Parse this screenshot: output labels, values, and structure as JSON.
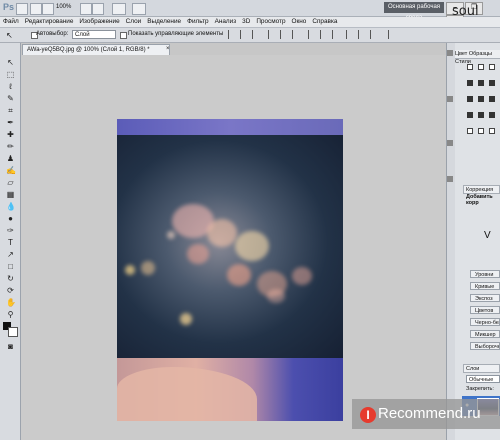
{
  "app": {
    "logo": "Ps",
    "zoom": "100%",
    "workspace": "Основная рабочая среда",
    "watermark_top": "soul girl"
  },
  "menu": [
    "Файл",
    "Редактирование",
    "Изображение",
    "Слои",
    "Выделение",
    "Фильтр",
    "Анализ",
    "3D",
    "Просмотр",
    "Окно",
    "Справка"
  ],
  "window_buttons": [
    "–",
    "❐",
    "✕"
  ],
  "options": {
    "autoselect_label": "Автовыбор:",
    "layer_value": "Слой",
    "show_controls_label": "Показать управляющие элементы"
  },
  "document": {
    "tab_title": "AWa-yeQ5BQ.jpg @ 100% (Слой 1, RGB/8) *"
  },
  "tools": [
    "move-tool",
    "marquee-tool",
    "lasso-tool",
    "quick-select-tool",
    "crop-tool",
    "eyedropper-tool",
    "healing-tool",
    "brush-tool",
    "stamp-tool",
    "history-brush-tool",
    "eraser-tool",
    "gradient-tool",
    "blur-tool",
    "dodge-tool",
    "pen-tool",
    "type-tool",
    "path-select-tool",
    "shape-tool",
    "3d-rotate-tool",
    "3d-camera-tool",
    "hand-tool",
    "zoom-tool"
  ],
  "right_panel": {
    "tabs": [
      "Цвет",
      "Образцы",
      "Стили"
    ],
    "adjustments_tab": "Коррекция",
    "adjustments_add": "Добавить корр",
    "adjust_items": [
      "Уровни",
      "Кривые",
      "Экспоз",
      "Цветов",
      "Черно-бел",
      "Микшер",
      "Выборочн"
    ],
    "layers_tab": "Слои",
    "blend_mode": "Обычные",
    "lock_label": "Закрепить:"
  },
  "recommend": {
    "badge": "I",
    "text": "Recommend.ru"
  }
}
